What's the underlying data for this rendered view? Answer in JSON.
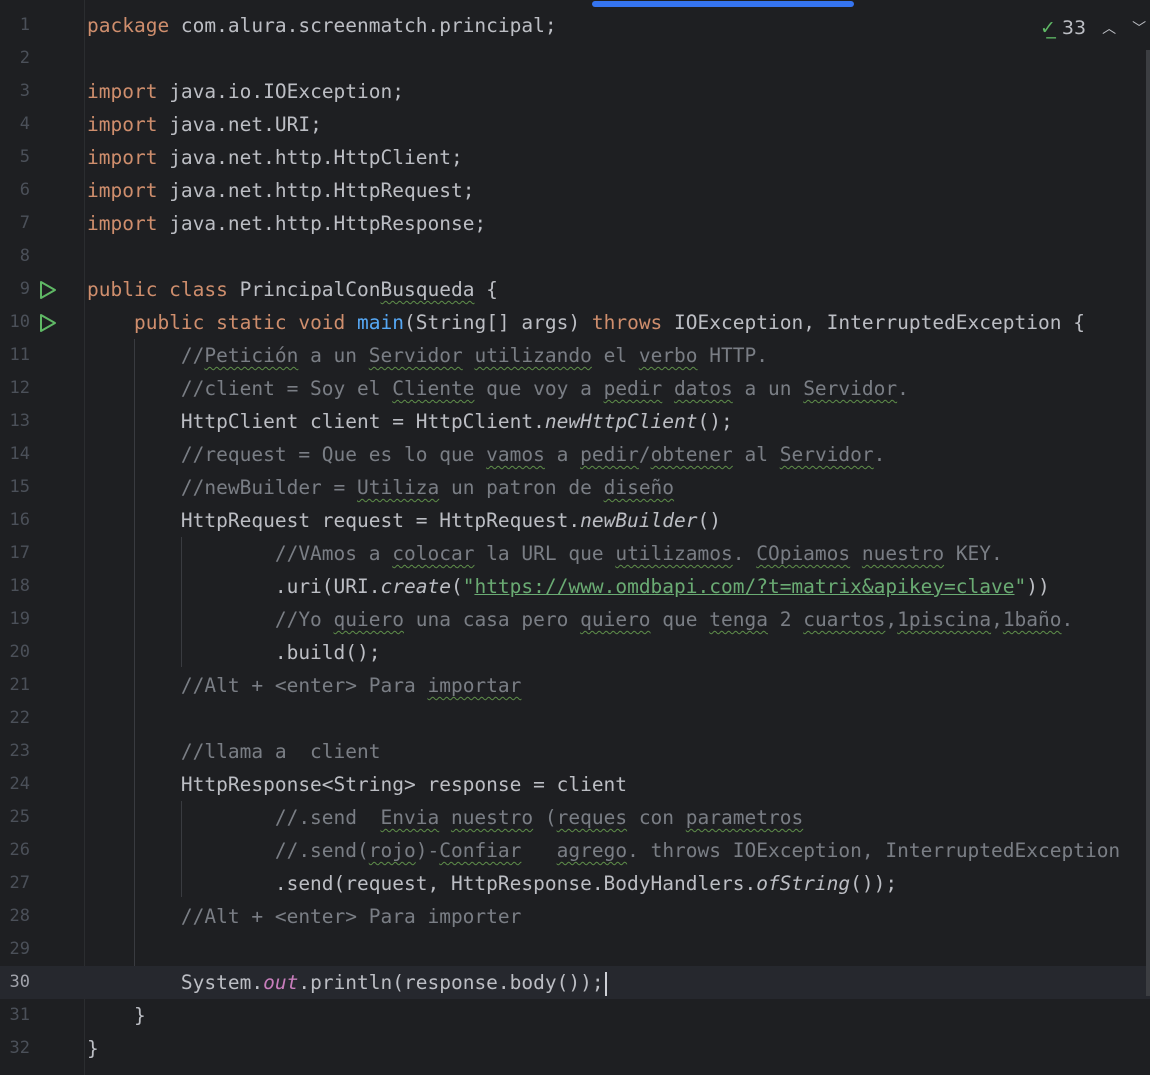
{
  "editor": {
    "scroll_position_fraction": 0.52,
    "inspection": {
      "icon": "check-double-icon",
      "count": "33",
      "prev_icon": "chevron-up-icon",
      "next_icon": "chevron-down-icon"
    },
    "current_line": 30,
    "lines": [
      {
        "n": "1",
        "tokens": [
          [
            "package",
            "k"
          ],
          [
            " com.alura.screenmatch.principal;",
            ""
          ]
        ]
      },
      {
        "n": "2",
        "tokens": []
      },
      {
        "n": "3",
        "tokens": [
          [
            "import",
            "k"
          ],
          [
            " java.io.IOException;",
            ""
          ]
        ]
      },
      {
        "n": "4",
        "tokens": [
          [
            "import",
            "k"
          ],
          [
            " java.net.URI;",
            ""
          ]
        ]
      },
      {
        "n": "5",
        "tokens": [
          [
            "import",
            "k"
          ],
          [
            " java.net.http.HttpClient;",
            ""
          ]
        ]
      },
      {
        "n": "6",
        "tokens": [
          [
            "import",
            "k"
          ],
          [
            " java.net.http.HttpRequest;",
            ""
          ]
        ]
      },
      {
        "n": "7",
        "tokens": [
          [
            "import",
            "k"
          ],
          [
            " java.net.http.HttpResponse;",
            ""
          ]
        ]
      },
      {
        "n": "8",
        "tokens": []
      },
      {
        "n": "9",
        "run": true,
        "tokens": [
          [
            "public class",
            "k"
          ],
          [
            " PrincipalCon",
            ""
          ],
          [
            "Busqueda",
            "sq"
          ],
          [
            " {",
            ""
          ]
        ]
      },
      {
        "n": "10",
        "run": true,
        "tokens": [
          [
            "    ",
            ""
          ],
          [
            "public static void",
            "k"
          ],
          [
            " ",
            ""
          ],
          [
            "main",
            "fn"
          ],
          [
            "(String[] args) ",
            ""
          ],
          [
            "throws",
            "k"
          ],
          [
            " IOException, InterruptedException {",
            ""
          ]
        ]
      },
      {
        "n": "11",
        "tokens": [
          [
            "        //",
            "c"
          ],
          [
            "Petición",
            "c sq"
          ],
          [
            " a un ",
            "c"
          ],
          [
            "Servidor",
            "c sq"
          ],
          [
            " ",
            "c"
          ],
          [
            "utilizando",
            "c sq"
          ],
          [
            " el ",
            "c"
          ],
          [
            "verbo",
            "c sq"
          ],
          [
            " HTTP.",
            "c"
          ]
        ]
      },
      {
        "n": "12",
        "tokens": [
          [
            "        //client = Soy el ",
            "c"
          ],
          [
            "Cliente",
            "c sq"
          ],
          [
            " que voy a ",
            "c"
          ],
          [
            "pedir",
            "c sq"
          ],
          [
            " ",
            "c"
          ],
          [
            "datos",
            "c sq"
          ],
          [
            " a un ",
            "c"
          ],
          [
            "Servidor",
            "c sq"
          ],
          [
            ".",
            "c"
          ]
        ]
      },
      {
        "n": "13",
        "tokens": [
          [
            "        HttpClient client = HttpClient.",
            ""
          ],
          [
            "newHttpClient",
            "it"
          ],
          [
            "();",
            ""
          ]
        ]
      },
      {
        "n": "14",
        "tokens": [
          [
            "        //request = Que es lo que ",
            "c"
          ],
          [
            "vamos",
            "c sq"
          ],
          [
            " a ",
            "c"
          ],
          [
            "pedir",
            "c sq"
          ],
          [
            "/",
            "c"
          ],
          [
            "obtener",
            "c sq"
          ],
          [
            " al ",
            "c"
          ],
          [
            "Servidor",
            "c sq"
          ],
          [
            ".",
            "c"
          ]
        ]
      },
      {
        "n": "15",
        "tokens": [
          [
            "        //newBuilder = ",
            "c"
          ],
          [
            "Utiliza",
            "c sq"
          ],
          [
            " un patron de ",
            "c"
          ],
          [
            "diseño",
            "c sq"
          ]
        ]
      },
      {
        "n": "16",
        "tokens": [
          [
            "        HttpRequest request = HttpRequest.",
            ""
          ],
          [
            "newBuilder",
            "it"
          ],
          [
            "()",
            ""
          ]
        ]
      },
      {
        "n": "17",
        "tokens": [
          [
            "                //VAmos a ",
            "c"
          ],
          [
            "colocar",
            "c sq"
          ],
          [
            " la URL que ",
            "c"
          ],
          [
            "utilizamos",
            "c sq"
          ],
          [
            ". ",
            "c"
          ],
          [
            "COpiamos",
            "c sq"
          ],
          [
            " ",
            "c"
          ],
          [
            "nuestro",
            "c sq"
          ],
          [
            " KEY.",
            "c"
          ]
        ]
      },
      {
        "n": "18",
        "tokens": [
          [
            "                .uri(URI.",
            ""
          ],
          [
            "create",
            "it"
          ],
          [
            "(",
            ""
          ],
          [
            "\"",
            "s"
          ],
          [
            "https://www.omdbapi.com/?t=matrix&apikey=clave",
            "s lnk"
          ],
          [
            "\"",
            "s"
          ],
          [
            "))",
            ""
          ]
        ]
      },
      {
        "n": "19",
        "tokens": [
          [
            "                //Yo ",
            "c"
          ],
          [
            "quiero",
            "c sq"
          ],
          [
            " una casa pero ",
            "c"
          ],
          [
            "quiero",
            "c sq"
          ],
          [
            " que ",
            "c"
          ],
          [
            "tenga",
            "c sq"
          ],
          [
            " 2 ",
            "c"
          ],
          [
            "cuartos",
            "c sq"
          ],
          [
            ",",
            "c"
          ],
          [
            "1piscina",
            "c sq"
          ],
          [
            ",",
            "c"
          ],
          [
            "1baño",
            "c sq"
          ],
          [
            ".",
            "c"
          ]
        ]
      },
      {
        "n": "20",
        "tokens": [
          [
            "                .build();",
            ""
          ]
        ]
      },
      {
        "n": "21",
        "tokens": [
          [
            "        //Alt + <enter> Para ",
            "c"
          ],
          [
            "importar",
            "c sq"
          ]
        ]
      },
      {
        "n": "22",
        "tokens": []
      },
      {
        "n": "23",
        "tokens": [
          [
            "        //llama a  client",
            "c"
          ]
        ]
      },
      {
        "n": "24",
        "tokens": [
          [
            "        HttpResponse<String> response = client",
            ""
          ]
        ]
      },
      {
        "n": "25",
        "tokens": [
          [
            "                //.send  ",
            "c"
          ],
          [
            "Envia",
            "c sq"
          ],
          [
            " ",
            "c"
          ],
          [
            "nuestro",
            "c sq"
          ],
          [
            " (",
            "c"
          ],
          [
            "reques",
            "c sq"
          ],
          [
            " con ",
            "c"
          ],
          [
            "parametros",
            "c sq"
          ]
        ]
      },
      {
        "n": "26",
        "tokens": [
          [
            "                //.send(",
            "c"
          ],
          [
            "rojo",
            "c sq"
          ],
          [
            ")-",
            "c"
          ],
          [
            "Confiar",
            "c sq"
          ],
          [
            "   ",
            "c"
          ],
          [
            "agrego",
            "c sq"
          ],
          [
            ". throws IOException, InterruptedException",
            "c"
          ]
        ]
      },
      {
        "n": "27",
        "tokens": [
          [
            "                .send(request, HttpResponse.BodyHandlers.",
            ""
          ],
          [
            "ofString",
            "it"
          ],
          [
            "());",
            ""
          ]
        ]
      },
      {
        "n": "28",
        "tokens": [
          [
            "        //Alt + <enter> Para importer",
            "c"
          ]
        ]
      },
      {
        "n": "29",
        "tokens": []
      },
      {
        "n": "30",
        "tokens": [
          [
            "        System.",
            ""
          ],
          [
            "out",
            "st"
          ],
          [
            ".println(response.body());",
            ""
          ]
        ]
      },
      {
        "n": "31",
        "tokens": [
          [
            "    }",
            ""
          ]
        ]
      },
      {
        "n": "32",
        "tokens": [
          [
            "}",
            ""
          ]
        ]
      }
    ]
  }
}
